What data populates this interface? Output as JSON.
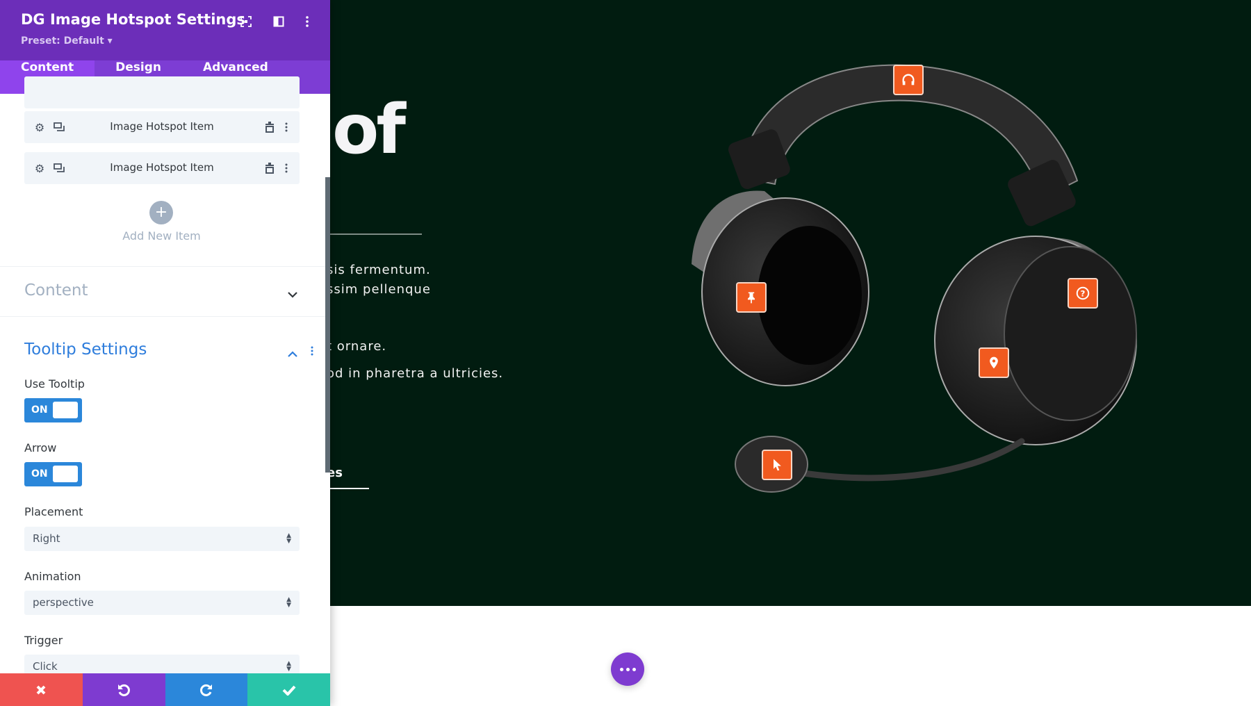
{
  "colors": {
    "header": "#6c2eb9",
    "tabs": "#7d3dd4",
    "active_tab": "#8f44ec",
    "accent_blue": "#2b87da",
    "hotspot": "#f15a1f",
    "stage_bg": "#011c10",
    "discard": "#ef5350",
    "undo": "#7e3bd0",
    "redo": "#2b87da",
    "save": "#29c4a9"
  },
  "panel": {
    "title": "DG Image Hotspot Settings",
    "preset": "Preset: Default ▾",
    "header_icons": [
      "focus-icon",
      "split-view-icon",
      "more-vertical-icon"
    ],
    "tabs": [
      {
        "label": "Content",
        "active": true
      },
      {
        "label": "Design",
        "active": false
      },
      {
        "label": "Advanced",
        "active": false
      }
    ],
    "items": [
      {
        "label": "Image Hotspot Item"
      },
      {
        "label": "Image Hotspot Item"
      }
    ],
    "add_new": "Add New Item",
    "content_section": "Content",
    "tooltip_section": "Tooltip Settings",
    "use_tooltip": {
      "label": "Use Tooltip",
      "value": "ON"
    },
    "arrow": {
      "label": "Arrow",
      "value": "ON"
    },
    "placement": {
      "label": "Placement",
      "value": "Right"
    },
    "animation": {
      "label": "Animation",
      "value": "perspective"
    },
    "trigger": {
      "label": "Trigger",
      "value": "Click"
    },
    "actions": [
      "close-icon",
      "undo-icon",
      "redo-icon",
      "check-icon"
    ]
  },
  "stage": {
    "heading": "of",
    "lines": [
      "sis fermentum.",
      "ssim pellenque",
      "t ornare.",
      "od in pharetra a ultricies."
    ],
    "link": "es",
    "hotspots": [
      "headphones-icon",
      "pin-icon",
      "question-icon",
      "location-icon",
      "cursor-icon"
    ]
  }
}
